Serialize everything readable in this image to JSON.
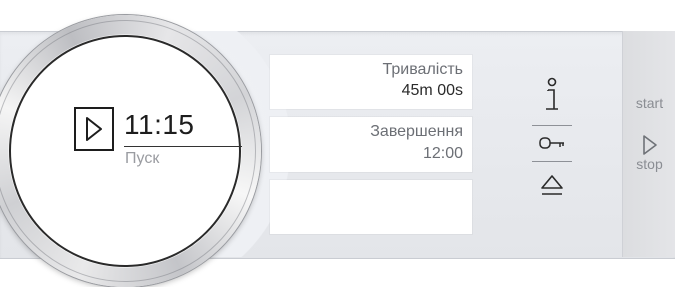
{
  "knob": {
    "time": "11:15",
    "status": "Пуск",
    "play_icon": "play-outline-icon"
  },
  "info": {
    "duration_title": "Тривалість",
    "duration_value": "45m 00s",
    "finish_title": "Завершення",
    "finish_value": "12:00",
    "empty_box": ""
  },
  "side_icons": [
    "info-icon",
    "key-icon",
    "eject-icon"
  ],
  "start_stop": {
    "start_label": "start",
    "stop_label": "stop",
    "icon": "play-outline-icon"
  },
  "colors": {
    "panel": "#e6e8ec",
    "text_dark": "#1d1d1d",
    "text_muted": "#9a9ca1"
  }
}
